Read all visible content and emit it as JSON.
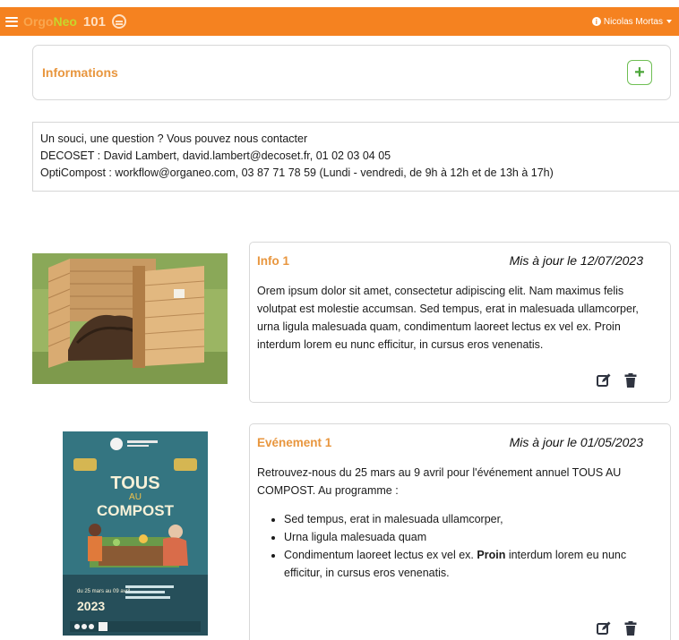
{
  "topbar": {
    "logo_orgo": "Orgo",
    "logo_neo": "Neo",
    "logo_num": "101",
    "user_name": "Nicolas Mortas",
    "brand_color": "#f58220"
  },
  "info_header": {
    "title": "Informations",
    "add_label": "+"
  },
  "contact": {
    "line1": "Un souci, une question ? Vous pouvez nous contacter",
    "line2": "DECOSET : David Lambert, david.lambert@decoset.fr, 01 02 03 04 05",
    "line3": "OptiCompost : workflow@organeo.com, 03 87 71 78 59 (Lundi - vendredi, de 9h à 12h et de 13h à 17h)"
  },
  "posts": [
    {
      "title": "Info 1",
      "date": "Mis à jour le 12/07/2023",
      "body": "Orem ipsum dolor sit amet, consectetur adipiscing elit. Nam maximus felis volutpat est molestie accumsan. Sed tempus, erat in malesuada ullamcorper, urna ligula malesuada quam, condimentum laoreet lectus ex vel ex. Proin interdum lorem eu nunc efficitur, in cursus eros venenatis."
    },
    {
      "title": "Evénement 1",
      "date": "Mis à jour le 01/05/2023",
      "intro": "Retrouvez-nous du 25 mars au 9 avril pour l'événement annuel TOUS AU COMPOST. Au programme :",
      "bullets": [
        "Sed tempus, erat in malesuada ullamcorper,",
        "Urna ligula malesuada quam"
      ],
      "bullet3_pre": "Condimentum laoreet lectus ex vel ex. ",
      "bullet3_bold": "Proin",
      "bullet3_post": " interdum lorem eu nunc efficitur, in cursus eros venenatis.",
      "poster": {
        "title_line1": "TOUS",
        "title_line2": "AU",
        "title_line3": "COMPOST",
        "dates": "du 25 mars au 09 avril",
        "year": "2023"
      }
    }
  ]
}
